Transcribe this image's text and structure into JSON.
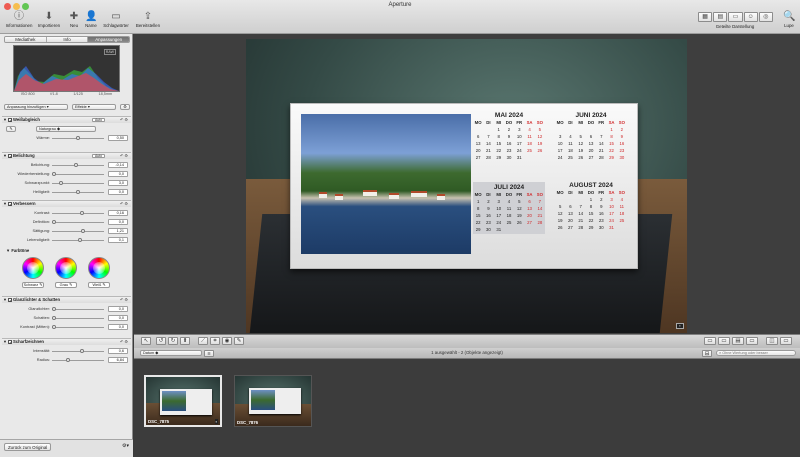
{
  "window": {
    "title": "Aperture"
  },
  "toolbar": {
    "left": [
      {
        "label": "Informationen",
        "icon": "info-icon"
      },
      {
        "label": "Importieren",
        "icon": "import-icon"
      },
      {
        "label": "Neu",
        "icon": "new-icon"
      },
      {
        "label": "Name",
        "icon": "person-icon"
      },
      {
        "label": "Schlagwörter",
        "icon": "keywords-icon"
      },
      {
        "label": "Bereitstellen",
        "icon": "share-icon"
      }
    ],
    "view_label": "Geteilte Darstellung",
    "loupe_label": "Lupe"
  },
  "inspector": {
    "tabs": [
      "Mediathek",
      "Info",
      "Anpassungen"
    ],
    "active_tab": "Anpassungen",
    "histogram": {
      "badge": "RAW",
      "info": [
        "ISO 800",
        "f/1.8",
        "1/125",
        "18,5mm"
      ]
    },
    "add_adjustment": "Anpassung hinzufügen",
    "effects": "Effekte",
    "white_balance": {
      "title": "Weißabgleich",
      "auto": "Auto",
      "mode": "Naturgrau",
      "warmth_label": "Wärme:",
      "warmth_value": "0,50",
      "warmth_pos": 0.5
    },
    "exposure": {
      "title": "Belichtung",
      "auto": "Auto",
      "rows": [
        {
          "label": "Belichtung:",
          "value": "-0,14",
          "pos": 0.45
        },
        {
          "label": "Wiederherstellung:",
          "value": "0,0",
          "pos": 0.0
        },
        {
          "label": "Schwarzpunkt:",
          "value": "3,0",
          "pos": 0.15
        },
        {
          "label": "Helligkeit:",
          "value": "0,0",
          "pos": 0.5
        }
      ]
    },
    "enhance": {
      "title": "Verbessern",
      "rows": [
        {
          "label": "Kontrast:",
          "value": "0,16",
          "pos": 0.58
        },
        {
          "label": "Definition:",
          "value": "0,0",
          "pos": 0.0
        },
        {
          "label": "Sättigung:",
          "value": "1,21",
          "pos": 0.6
        },
        {
          "label": "Lebendigkeit:",
          "value": "0,1",
          "pos": 0.55
        }
      ],
      "tones_label": "Farbtöne",
      "wheels": [
        "Schwarz",
        "Grau",
        "Weiß"
      ]
    },
    "highlights": {
      "title": "Glanzlichter & Schatten",
      "rows": [
        {
          "label": "Glanzlichter:",
          "value": "0,0",
          "pos": 0.0
        },
        {
          "label": "Schatten:",
          "value": "0,0",
          "pos": 0.0
        },
        {
          "label": "Kontrast (Mitten):",
          "value": "0,0",
          "pos": 0.0
        }
      ]
    },
    "sharpen": {
      "title": "Scharfzeichnen",
      "rows": [
        {
          "label": "Intensität:",
          "value": "0,6",
          "pos": 0.58
        },
        {
          "label": "Radius:",
          "value": "6,84",
          "pos": 0.3
        }
      ]
    },
    "reset": "Zurück zum Original"
  },
  "calendar": {
    "weekdays": [
      "MO",
      "DI",
      "MI",
      "DO",
      "FR",
      "SA",
      "SO"
    ],
    "months": [
      {
        "name": "MAI 2024",
        "days": [
          "",
          "",
          "1",
          "2",
          "3",
          "4",
          "5",
          "6",
          "7",
          "8",
          "9",
          "10",
          "11",
          "12",
          "13",
          "14",
          "15",
          "16",
          "17",
          "18",
          "19",
          "20",
          "21",
          "22",
          "23",
          "24",
          "25",
          "26",
          "27",
          "28",
          "29",
          "30",
          "31"
        ]
      },
      {
        "name": "JUNI 2024",
        "days": [
          "",
          "",
          "",
          "",
          "",
          "1",
          "2",
          "3",
          "4",
          "5",
          "6",
          "7",
          "8",
          "9",
          "10",
          "11",
          "12",
          "13",
          "14",
          "15",
          "16",
          "17",
          "18",
          "19",
          "20",
          "21",
          "22",
          "23",
          "24",
          "25",
          "26",
          "27",
          "28",
          "29",
          "30"
        ]
      },
      {
        "name": "JULI 2024",
        "days": [
          "1",
          "2",
          "3",
          "4",
          "5",
          "6",
          "7",
          "8",
          "9",
          "10",
          "11",
          "12",
          "13",
          "14",
          "15",
          "16",
          "17",
          "18",
          "19",
          "20",
          "21",
          "22",
          "23",
          "24",
          "25",
          "26",
          "27",
          "28",
          "29",
          "30",
          "31"
        ]
      },
      {
        "name": "AUGUST 2024",
        "days": [
          "",
          "",
          "",
          "1",
          "2",
          "3",
          "4",
          "5",
          "6",
          "7",
          "8",
          "9",
          "10",
          "11",
          "12",
          "13",
          "14",
          "15",
          "16",
          "17",
          "18",
          "19",
          "20",
          "21",
          "22",
          "23",
          "24",
          "25",
          "26",
          "27",
          "28",
          "29",
          "30",
          "31"
        ]
      }
    ]
  },
  "browser": {
    "sort": "Datum",
    "status": "1 ausgewählt - 2 (Objekte angezeigt)",
    "search_placeholder": "Ohne Wertung oder besser",
    "thumbs": [
      {
        "name": "DSC_7875",
        "selected": true
      },
      {
        "name": "DSC_7876",
        "selected": false
      }
    ]
  }
}
